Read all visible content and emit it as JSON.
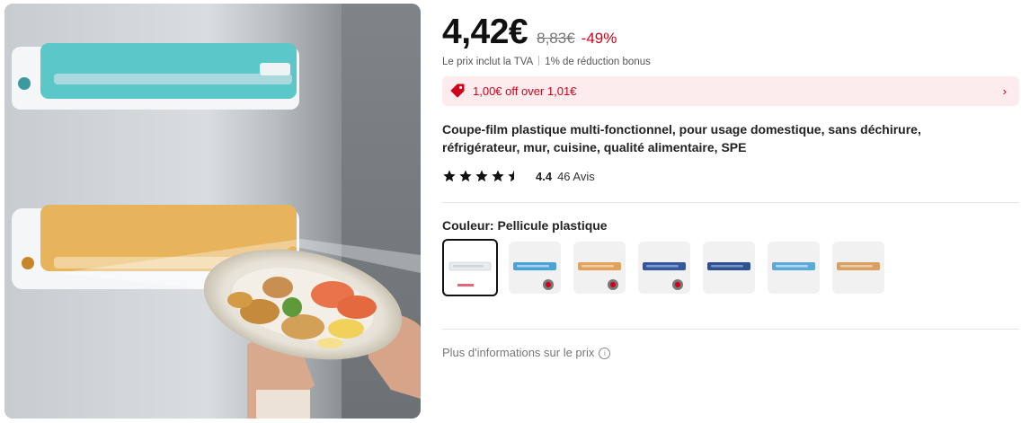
{
  "product": {
    "image_alt": "Coupe-film plastique distributeur mural",
    "price_current": "4,42€",
    "price_original": "8,83€",
    "discount": "-49%",
    "vat_text": "Le prix inclut la TVA",
    "bonus_text": "1% de réduction bonus",
    "title": "Coupe-film plastique multi-fonctionnel, pour usage domestique, sans déchirure, réfrigérateur, mur, cuisine, qualité alimentaire, SPE",
    "rating": 4.4,
    "rating_text": "4.4",
    "stars": 4.4,
    "review_count": "46 Avis"
  },
  "coupon": {
    "text": "1,00€ off over 1,01€",
    "icon": "tag-icon",
    "chevron": "›"
  },
  "color": {
    "label": "Couleur: Pellicule plastique",
    "options": [
      {
        "name": "white",
        "color": "#e9ecef",
        "selected": true
      },
      {
        "name": "sky-blue",
        "color": "#4aa3d6",
        "selected": false
      },
      {
        "name": "orange",
        "color": "#e3a15d",
        "selected": false
      },
      {
        "name": "navy",
        "color": "#35579e",
        "selected": false
      },
      {
        "name": "navy-2",
        "color": "#2e5190",
        "selected": false
      },
      {
        "name": "light-blue",
        "color": "#5aa9d8",
        "selected": false
      },
      {
        "name": "tan",
        "color": "#d9a064",
        "selected": false
      }
    ]
  },
  "more_info": "Plus d'informations sur le prix",
  "colors": {
    "accent": "#d0021b",
    "coupon_bg": "#fdeced"
  }
}
